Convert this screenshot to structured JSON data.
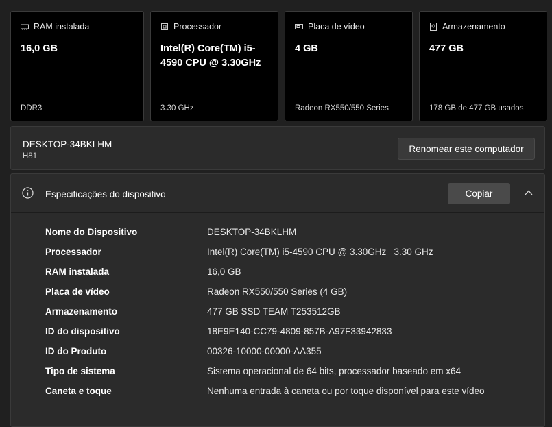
{
  "cards": [
    {
      "icon": "ram-icon",
      "title": "RAM instalada",
      "value": "16,0 GB",
      "foot": "DDR3"
    },
    {
      "icon": "processor-icon",
      "title": "Processador",
      "value": "Intel(R) Core(TM) i5-4590 CPU @ 3.30GHz",
      "foot": "3.30 GHz"
    },
    {
      "icon": "gpu-icon",
      "title": "Placa de vídeo",
      "value": "4 GB",
      "foot": "Radeon RX550/550 Series"
    },
    {
      "icon": "storage-icon",
      "title": "Armazenamento",
      "value": "477 GB",
      "foot": "178 GB de 477 GB usados"
    }
  ],
  "pc": {
    "name": "DESKTOP-34BKLHM",
    "sub": "H81",
    "rename_label": "Renomear este computador"
  },
  "specs": {
    "title": "Especificações do dispositivo",
    "copy_label": "Copiar",
    "rows": [
      {
        "label": "Nome do Dispositivo",
        "value": "DESKTOP-34BKLHM"
      },
      {
        "label": "Processador",
        "value": "Intel(R) Core(TM) i5-4590 CPU @ 3.30GHz   3.30 GHz"
      },
      {
        "label": "RAM instalada",
        "value": "16,0 GB"
      },
      {
        "label": "Placa de vídeo",
        "value": "Radeon RX550/550 Series (4 GB)"
      },
      {
        "label": "Armazenamento",
        "value": "477 GB SSD TEAM T253512GB"
      },
      {
        "label": "ID do dispositivo",
        "value": "18E9E140-CC79-4809-857B-A97F33942833"
      },
      {
        "label": "ID do Produto",
        "value": "00326-10000-00000-AA355"
      },
      {
        "label": "Tipo de sistema",
        "value": "Sistema operacional de 64 bits, processador baseado em x64"
      },
      {
        "label": "Caneta e toque",
        "value": "Nenhuma entrada à caneta ou por toque disponível para este vídeo"
      }
    ]
  }
}
